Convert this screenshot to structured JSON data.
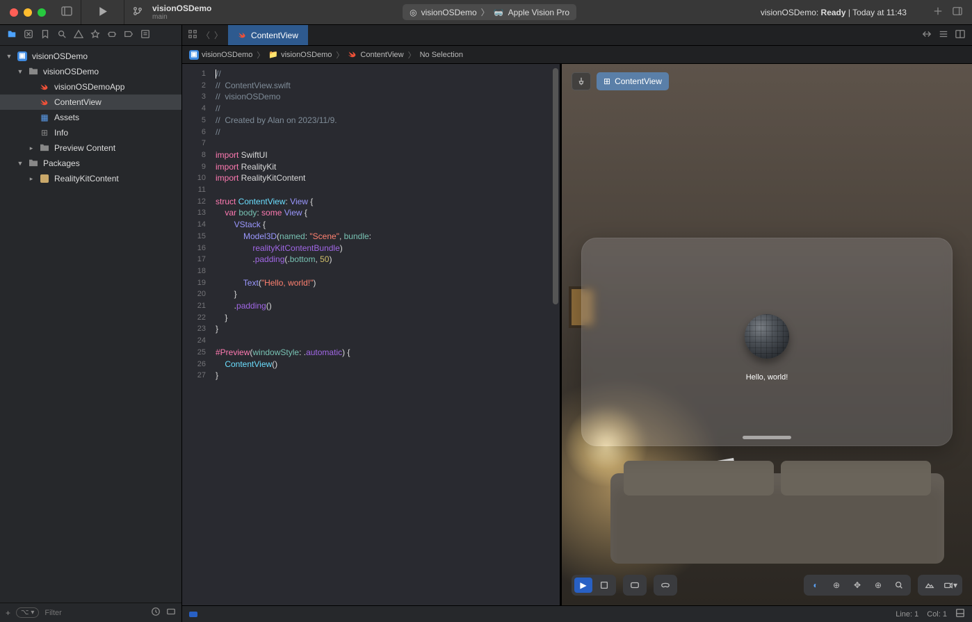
{
  "titlebar": {
    "project_name": "visionOSDemo",
    "branch_name": "main",
    "scheme": "visionOSDemo",
    "destination": "Apple Vision Pro",
    "status_prefix": "visionOSDemo: ",
    "status_bold": "Ready",
    "status_suffix": " | Today at 11:43"
  },
  "navigator": {
    "items": [
      {
        "label": "visionOSDemo",
        "indent": 0,
        "icon": "app",
        "chev": "▼"
      },
      {
        "label": "visionOSDemo",
        "indent": 1,
        "icon": "folder",
        "chev": "▼"
      },
      {
        "label": "visionOSDemoApp",
        "indent": 2,
        "icon": "swift",
        "chev": ""
      },
      {
        "label": "ContentView",
        "indent": 2,
        "icon": "swift",
        "chev": "",
        "selected": true
      },
      {
        "label": "Assets",
        "indent": 2,
        "icon": "assets",
        "chev": ""
      },
      {
        "label": "Info",
        "indent": 2,
        "icon": "info",
        "chev": ""
      },
      {
        "label": "Preview Content",
        "indent": 2,
        "icon": "folder",
        "chev": "▸"
      },
      {
        "label": "Packages",
        "indent": 1,
        "icon": "folder",
        "chev": "▼"
      },
      {
        "label": "RealityKitContent",
        "indent": 2,
        "icon": "pkg",
        "chev": "▸"
      }
    ],
    "filter_placeholder": "Filter"
  },
  "tabbar": {
    "active_tab": "ContentView"
  },
  "breadcrumb": {
    "parts": [
      "visionOSDemo",
      "visionOSDemo",
      "ContentView",
      "No Selection"
    ]
  },
  "code": {
    "line_count": 27,
    "lines": {
      "l1": "//",
      "l2_a": "//  ",
      "l2_b": "ContentView.swift",
      "l3_a": "//  ",
      "l3_b": "visionOSDemo",
      "l4": "//",
      "l5_a": "//  ",
      "l5_b": "Created by Alan on 2023/11/9.",
      "l6": "//",
      "l8_kw": "import",
      "l8_id": " SwiftUI",
      "l9_kw": "import",
      "l9_id": " RealityKit",
      "l10_kw": "import",
      "l10_id": " RealityKitContent",
      "l12_kw": "struct ",
      "l12_ty": "ContentView",
      "l12_c": ": ",
      "l12_ty2": "View",
      "l12_b": " {",
      "l13_kw": "    var ",
      "l13_id": "body",
      "l13_c": ": ",
      "l13_kw2": "some ",
      "l13_ty": "View",
      "l13_b": " {",
      "l14_ty": "        VStack",
      "l14_b": " {",
      "l15_ty": "            Model3D",
      "l15_p": "(",
      "l15_a1": "named",
      "l15_c1": ": ",
      "l15_s": "\"Scene\"",
      "l15_c2": ", ",
      "l15_a2": "bundle",
      "l15_c3": ":",
      "l15b_id": "                realityKitContentBundle",
      "l15b_p": ")",
      "l16_c": "                .",
      "l16_f": "padding",
      "l16_p": "(.",
      "l16_a": "bottom",
      "l16_c2": ", ",
      "l16_n": "50",
      "l16_p2": ")",
      "l18_ty": "            Text",
      "l18_p": "(",
      "l18_s": "\"Hello, world!\"",
      "l18_p2": ")",
      "l19": "        }",
      "l20_c": "        .",
      "l20_f": "padding",
      "l20_p": "()",
      "l21": "    }",
      "l22": "}",
      "l24_a": "#Preview",
      "l24_p": "(",
      "l24_arg": "windowStyle",
      "l24_c": ": .",
      "l24_v": "automatic",
      "l24_p2": ") {",
      "l25_ty": "    ContentView",
      "l25_p": "()",
      "l26": "}"
    }
  },
  "canvas": {
    "preview_chip": "ContentView",
    "hello_text": "Hello, world!"
  },
  "statusbar": {
    "line": "Line: 1",
    "col": "Col: 1"
  }
}
